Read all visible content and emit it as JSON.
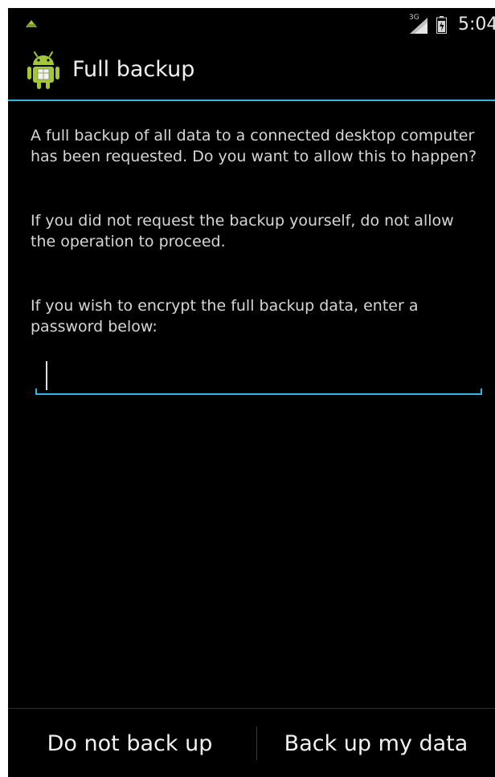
{
  "status_bar": {
    "notification_icon": "android-notification-icon",
    "network_type": "3G",
    "signal_icon": "signal-icon",
    "battery_icon": "battery-icon",
    "time": "5:04"
  },
  "title_bar": {
    "app_icon": "android-backup-icon",
    "title": "Full backup"
  },
  "body": {
    "paragraph_1": "A full backup of all data to a connected desktop computer has been requested. Do you want to allow this to happen?",
    "paragraph_2": "If you did not request the backup yourself, do not allow the operation to proceed.",
    "paragraph_3": "If you wish to encrypt the full backup data, enter a password below:"
  },
  "password_field": {
    "value": "",
    "placeholder": ""
  },
  "buttons": {
    "deny_label": "Do not back up",
    "allow_label": "Back up my data"
  },
  "colors": {
    "background": "#000000",
    "accent": "#33b5e5",
    "text": "#d6d6d6",
    "android_green": "#a4c639"
  }
}
